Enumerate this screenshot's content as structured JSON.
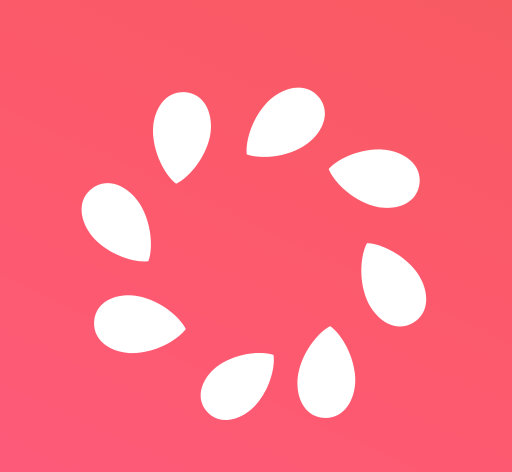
{
  "background": {
    "gradient_start": "#f85a62",
    "gradient_end": "#fd5a7a"
  },
  "logo": {
    "icon": "sunburst-petals-icon",
    "petal_color": "#ffffff",
    "petal_count": 8
  }
}
